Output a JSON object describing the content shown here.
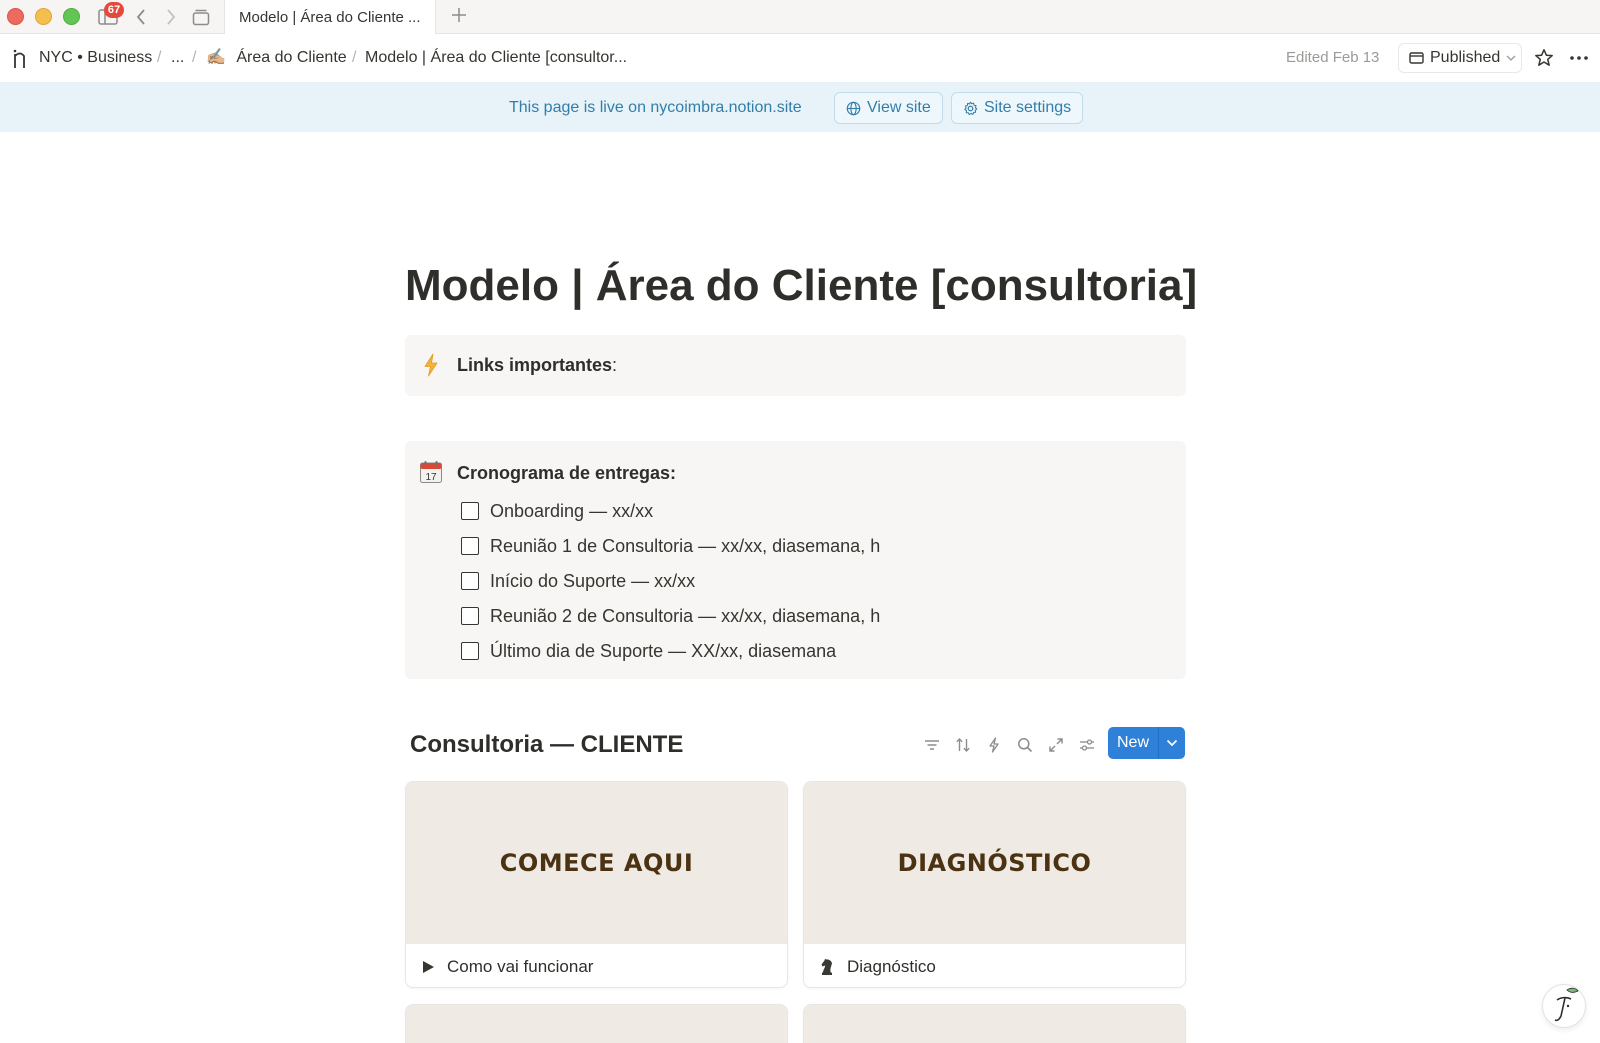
{
  "browser": {
    "tab_count_badge": "67",
    "active_tab_title": "Modelo | Área do Cliente ..."
  },
  "breadcrumb": {
    "workspace": "NYC • Business",
    "ellipsis": "...",
    "parent": "Área do Cliente",
    "parent_emoji": "✍🏼",
    "current": "Modelo | Área do Cliente [consultor..."
  },
  "topbar": {
    "edited": "Edited Feb 13",
    "published_label": "Published"
  },
  "banner": {
    "text": "This page is live on nycoimbra.notion.site",
    "view_site_label": "View site",
    "site_settings_label": "Site settings"
  },
  "page": {
    "title": "Modelo | Área do Cliente [consultoria]"
  },
  "callout_links": {
    "icon": "lightning-icon",
    "heading": "Links importantes",
    "colon": ":"
  },
  "callout_schedule": {
    "icon": "calendar-icon",
    "calendar_day": "17",
    "heading": "Cronograma de entregas:",
    "todos": [
      "Onboarding — xx/xx",
      "Reunião 1 de Consultoria — xx/xx, diasemana, h",
      "Início do Suporte — xx/xx",
      "Reunião 2 de Consultoria — xx/xx, diasemana, h",
      "Último dia de Suporte — XX/xx, diasemana"
    ]
  },
  "database": {
    "title": "Consultoria — CLIENTE",
    "new_label": "New",
    "toolbar_icons": [
      "filter-icon",
      "sort-icon",
      "automation-icon",
      "search-icon",
      "expand-icon",
      "settings-icon"
    ],
    "cards": [
      {
        "cover_text": "COMECE AQUI",
        "name": "Como vai funcionar",
        "icon": "play-triangle-icon"
      },
      {
        "cover_text": "DIAGNÓSTICO",
        "name": "Diagnóstico",
        "icon": "chess-knight-icon"
      }
    ]
  },
  "colors": {
    "accent_blue": "#2f80d8",
    "banner_bg": "#e7f3f8",
    "banner_text": "#337ea9",
    "cover_bg": "#efeae3",
    "cover_text": "#4a3212",
    "callout_bg": "#f7f6f4"
  }
}
